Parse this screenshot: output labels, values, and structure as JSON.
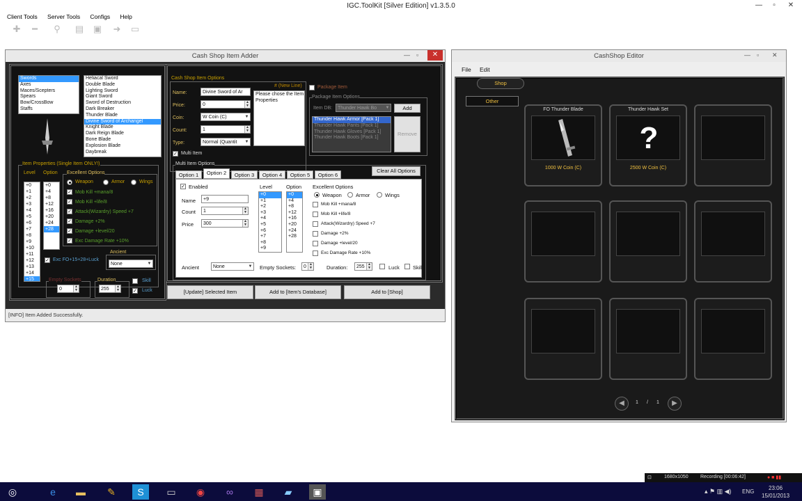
{
  "app": {
    "title": "IGC.ToolKit [Silver Edition] v1.3.5.0"
  },
  "menu": [
    "Client Tools",
    "Server Tools",
    "Configs",
    "Help"
  ],
  "adder": {
    "title": "Cash Shop Item Adder",
    "categories": [
      "Swords",
      "Axes",
      "Maces/Scepters",
      "Spears",
      "Bow/CrossBow",
      "Staffs"
    ],
    "items": [
      "Heliacal Sword",
      "Double Blade",
      "Lighting Sword",
      "Giant Sword",
      "Sword of Destruction",
      "Dark Breaker",
      "Thunder Blade",
      "Divine Sword of Archangel",
      "Knight Blade",
      "Dark Reign Blade",
      "Bone Blade",
      "Explosion Blade",
      "Daybreak"
    ],
    "props_title": "Item Properties (Single Item ONLY!)",
    "level_label": "Level",
    "option_label": "Option",
    "levels": [
      "+0",
      "+1",
      "+2",
      "+3",
      "+4",
      "+5",
      "+6",
      "+7",
      "+8",
      "+9",
      "+10",
      "+11",
      "+12",
      "+13",
      "+14",
      "+15"
    ],
    "options": [
      "+0",
      "+4",
      "+8",
      "+12",
      "+16",
      "+20",
      "+24",
      "+28"
    ],
    "exc_title": "Excellent Options",
    "weapon": "Weapon",
    "armor": "Armor",
    "wings": "Wings",
    "exc_options": [
      "Mob Kill +mana/8",
      "Mob Kill +life/8",
      "Attack(Wizardry) Speed +7",
      "Damage +2%",
      "Damage +level/20",
      "Exc Damage Rate +10%"
    ],
    "exc_fo": "Exc FO+15+28+Luck",
    "ancient_label": "Ancient",
    "ancient_value": "None",
    "sockets_label": "Empty Sockets",
    "sockets_value": "0",
    "duration_label": "Duration",
    "duration_value": "255",
    "skill": "Skill",
    "luck": "Luck",
    "shop_opts_title": "Cash Shop Item Options",
    "new_line": "# (New Line)",
    "name_label": "Name:",
    "name_value": "Divine Sword of Ar",
    "price_label": "Price:",
    "price_value": "0",
    "coin_label": "Coin:",
    "coin_value": "W Coin (C)",
    "count_label": "Count:",
    "count_value": "1",
    "type_label": "Type:",
    "type_value": "Normal (Quantit",
    "desc": "Please chose the Item Properties",
    "multi_item": "Multi Item",
    "package_item": "Package Item",
    "package_title": "Package Item Options",
    "item_db_label": "Item DB:",
    "item_db_value": "Thunder Hawk Bo",
    "add": "Add",
    "remove": "Remove",
    "package_list": [
      "Thunder Hawk Armor  [Pack 1]",
      "Thunder Hawk Pants  [Pack 1]",
      "Thunder Hawk Gloves  [Pack 1]",
      "Thunder Hawk Boots  [Pack 1]"
    ],
    "multi_title": "Multi Item Options",
    "tabs": [
      "Option 1",
      "Option 2",
      "Option 3",
      "Option 4",
      "Option 5",
      "Option 6"
    ],
    "clear_all": "Clear All Options",
    "enabled": "Enabled",
    "m_name_label": "Name",
    "m_name_value": "+9",
    "m_count_label": "Count",
    "m_count_value": "1",
    "m_price_label": "Price",
    "m_price_value": "300",
    "m_levels": [
      "+0",
      "+1",
      "+2",
      "+3",
      "+4",
      "+5",
      "+6",
      "+7",
      "+8",
      "+9"
    ],
    "m_options": [
      "+0",
      "+4",
      "+8",
      "+12",
      "+16",
      "+20",
      "+24",
      "+28"
    ],
    "m_sockets_label": "Empty Sockets:",
    "m_duration_label": "Duration:",
    "btn_update": "[Update] Selected Item",
    "btn_db": "Add to [Item's Database]",
    "btn_shop": "Add to [Shop]",
    "status": "[INFO] Item Added Successfully."
  },
  "editor": {
    "title": "CashShop Editor",
    "menu": [
      "File",
      "Edit"
    ],
    "tab_shop": "Shop",
    "tab_other": "Other",
    "slots": [
      {
        "name": "FO Thunder Blade",
        "price": "1000 W Coin (C)"
      },
      {
        "name": "Thunder Hawk Set",
        "price": "2500 W Coin (C)"
      }
    ],
    "page_current": "1",
    "page_sep": "/",
    "page_total": "1"
  },
  "tray": {
    "resolution": "1680x1050",
    "recording": "Recording [00:06:42]",
    "lang": "ENG",
    "time": "23:06",
    "date": "15/01/2013"
  }
}
